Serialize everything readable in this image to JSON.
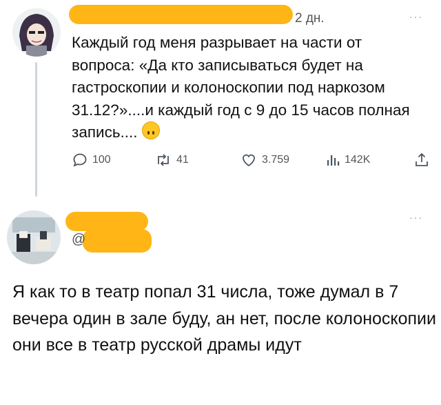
{
  "tweet1": {
    "time": "2 дн.",
    "text": "Каждый год меня разрывает на части от вопроса: «Да кто записываться будет на гастроскопии и колоноскопии под наркозом 31.12?»....и каждый год с 9 до 15 часов полная запись....",
    "replies": "100",
    "reposts": "41",
    "likes": "3.759",
    "views": "142K",
    "menu": "···"
  },
  "tweet2": {
    "handle_symbol": "@",
    "text": "Я как то в театр попал 31 числа, тоже думал в 7 вечера один в зале буду, ан нет, после колоноскопии они все в театр русской драмы идут",
    "menu": "···"
  },
  "colors": {
    "redaction": "#ffb515",
    "text": "#111111",
    "muted": "#555555"
  },
  "icons": [
    "reply-icon",
    "repost-icon",
    "like-icon",
    "views-icon",
    "share-icon",
    "upside-down-face-emoji"
  ]
}
